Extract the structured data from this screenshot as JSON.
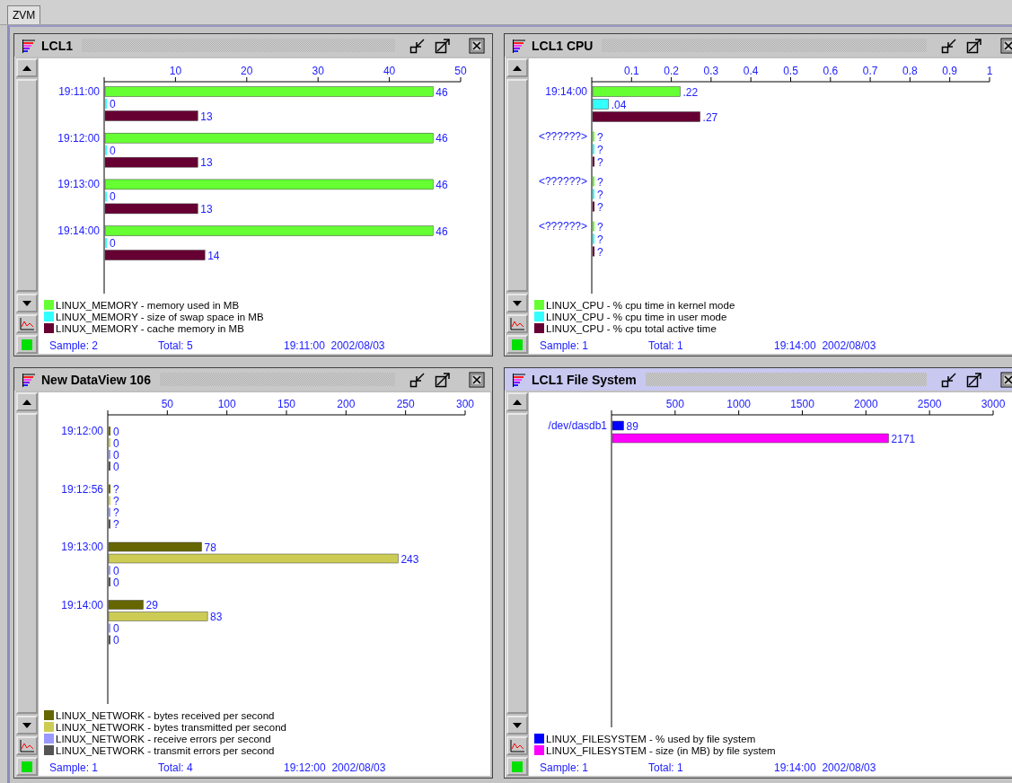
{
  "tabs": [
    {
      "label": "ZVM",
      "selected": true
    }
  ],
  "panels": [
    {
      "title": "LCL1",
      "active": false,
      "chart_data": {
        "type": "bar",
        "orientation": "horizontal",
        "categories": [
          "19:11:00",
          "19:12:00",
          "19:13:00",
          "19:14:00"
        ],
        "series": [
          {
            "name": "LINUX_MEMORY - memory used in MB",
            "color": "#66ff33",
            "values": [
              46,
              46,
              46,
              46
            ]
          },
          {
            "name": "LINUX_MEMORY - size of swap space in MB",
            "color": "#33ffff",
            "values": [
              0,
              0,
              0,
              0
            ]
          },
          {
            "name": "LINUX_MEMORY - cache memory in MB",
            "color": "#660033",
            "values": [
              13,
              13,
              13,
              14
            ]
          }
        ],
        "xlim": [
          0,
          50
        ],
        "xticks": [
          10,
          20,
          30,
          40,
          50
        ],
        "value_labels": [
          [
            "46",
            "46",
            "46",
            "46"
          ],
          [
            "0",
            "0",
            "0",
            "0"
          ],
          [
            "13",
            "13",
            "13",
            "14"
          ]
        ]
      },
      "status": {
        "sample": "Sample: 2",
        "total": "Total: 5",
        "timestamp": "19:11:00  2002/08/03"
      }
    },
    {
      "title": "LCL1 CPU",
      "active": false,
      "chart_data": {
        "type": "bar",
        "orientation": "horizontal",
        "categories": [
          "19:14:00",
          "<??????>",
          "<??????>",
          "<??????>"
        ],
        "series": [
          {
            "name": "LINUX_CPU - % cpu time in kernel mode",
            "color": "#66ff33",
            "values": [
              0.22,
              null,
              null,
              null
            ]
          },
          {
            "name": "LINUX_CPU - % cpu time in user mode",
            "color": "#33ffff",
            "values": [
              0.04,
              null,
              null,
              null
            ]
          },
          {
            "name": "LINUX_CPU - % cpu total active time",
            "color": "#660033",
            "values": [
              0.27,
              null,
              null,
              null
            ]
          }
        ],
        "xlim": [
          0,
          1
        ],
        "xticks": [
          0.1,
          0.2,
          0.3,
          0.4,
          0.5,
          0.6,
          0.7,
          0.8,
          0.9,
          1
        ],
        "value_labels": [
          [
            ".22",
            "?",
            "?",
            "?"
          ],
          [
            ".04",
            "?",
            "?",
            "?"
          ],
          [
            ".27",
            "?",
            "?",
            "?"
          ]
        ]
      },
      "status": {
        "sample": "Sample: 1",
        "total": "Total: 1",
        "timestamp": "19:14:00  2002/08/03"
      }
    },
    {
      "title": "New DataView 106",
      "active": false,
      "chart_data": {
        "type": "bar",
        "orientation": "horizontal",
        "categories": [
          "19:12:00",
          "19:12:56",
          "19:13:00",
          "19:14:00"
        ],
        "series": [
          {
            "name": "LINUX_NETWORK - bytes received per second",
            "color": "#666600",
            "values": [
              0,
              null,
              78,
              29
            ]
          },
          {
            "name": "LINUX_NETWORK - bytes transmitted per second",
            "color": "#cccc55",
            "values": [
              0,
              null,
              243,
              83
            ]
          },
          {
            "name": "LINUX_NETWORK - receive errors per second",
            "color": "#9999ff",
            "values": [
              0,
              null,
              0,
              0
            ]
          },
          {
            "name": "LINUX_NETWORK - transmit errors per second",
            "color": "#555555",
            "values": [
              0,
              null,
              0,
              0
            ]
          }
        ],
        "xlim": [
          0,
          300
        ],
        "xticks": [
          50,
          100,
          150,
          200,
          250,
          300
        ],
        "value_labels": [
          [
            "0",
            "?",
            "78",
            "29"
          ],
          [
            "0",
            "?",
            "243",
            "83"
          ],
          [
            "0",
            "?",
            "0",
            "0"
          ],
          [
            "0",
            "?",
            "0",
            "0"
          ]
        ]
      },
      "status": {
        "sample": "Sample: 1",
        "total": "Total: 4",
        "timestamp": "19:12:00  2002/08/03"
      }
    },
    {
      "title": "LCL1 File System",
      "active": true,
      "chart_data": {
        "type": "bar",
        "orientation": "horizontal",
        "categories": [
          "/dev/dasdb1"
        ],
        "series": [
          {
            "name": "LINUX_FILESYSTEM - % used by file system",
            "color": "#0000ff",
            "values": [
              89
            ]
          },
          {
            "name": "LINUX_FILESYSTEM - size (in MB) by file system",
            "color": "#ff00ff",
            "values": [
              2171
            ]
          }
        ],
        "xlim": [
          0,
          3000
        ],
        "xticks": [
          500,
          1000,
          1500,
          2000,
          2500,
          3000
        ],
        "value_labels": [
          [
            "89"
          ],
          [
            "2171"
          ]
        ]
      },
      "status": {
        "sample": "Sample: 1",
        "total": "Total: 1",
        "timestamp": "19:14:00  2002/08/03"
      }
    }
  ]
}
